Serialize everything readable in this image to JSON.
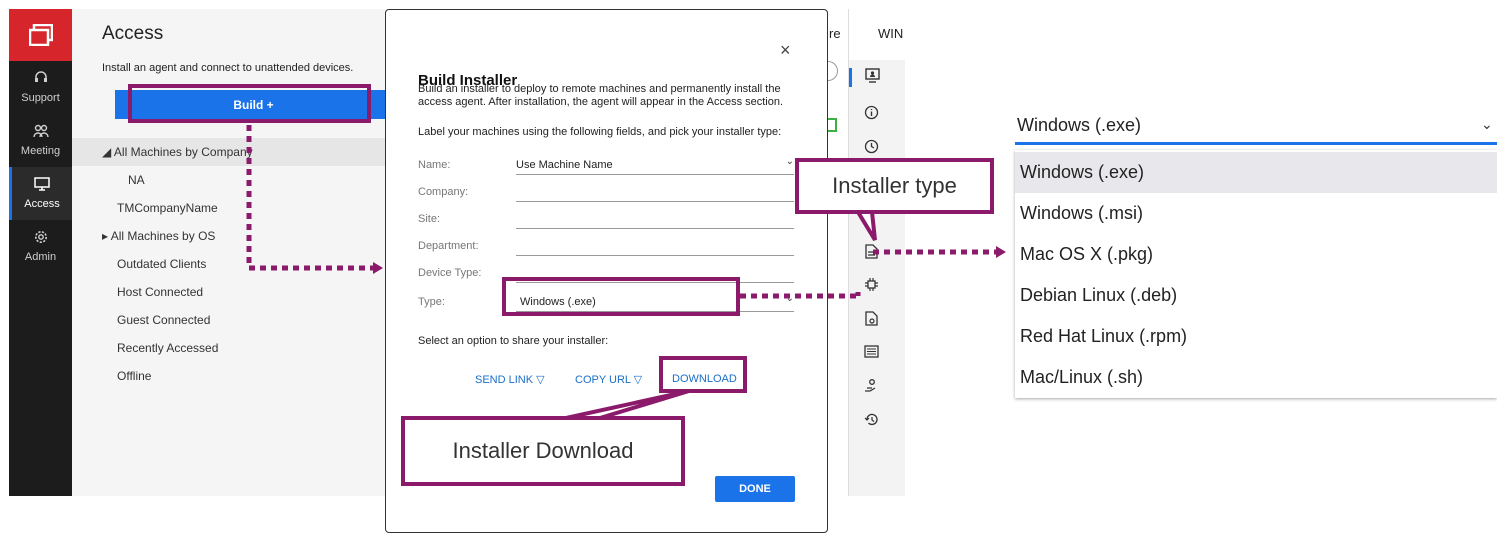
{
  "nav": {
    "items": [
      {
        "label": "Support",
        "icon": "headset-icon"
      },
      {
        "label": "Meeting",
        "icon": "people-icon"
      },
      {
        "label": "Access",
        "icon": "monitor-icon",
        "active": true
      },
      {
        "label": "Admin",
        "icon": "gear-icon"
      }
    ]
  },
  "access": {
    "title": "Access",
    "description": "Install an agent and connect to unattended devices.",
    "build_label": "Build +",
    "tree": [
      {
        "label": "◢ All Machines by Company",
        "indent": 0,
        "selected": true
      },
      {
        "label": "NA",
        "indent": 1
      },
      {
        "label": "TMCompanyName",
        "indent": 1
      },
      {
        "label": "▸ All Machines by OS",
        "indent": 0
      },
      {
        "label": "Outdated Clients",
        "indent": 0
      },
      {
        "label": "Host Connected",
        "indent": 0
      },
      {
        "label": "Guest Connected",
        "indent": 0
      },
      {
        "label": "Recently Accessed",
        "indent": 0
      },
      {
        "label": "Offline",
        "indent": 0
      }
    ]
  },
  "background": {
    "cut_text_1": "re",
    "cut_text_2": "WIN"
  },
  "dialog": {
    "title": "Build Installer",
    "close_glyph": "×",
    "intro": "Build an installer to deploy to remote machines and permanently install the access agent. After installation, the agent will appear in the Access section.",
    "fields_hint": "Label your machines using the following fields, and pick your installer type:",
    "fields": [
      {
        "label": "Name:",
        "value": "Use Machine Name",
        "dropdown": true
      },
      {
        "label": "Company:",
        "value": ""
      },
      {
        "label": "Site:",
        "value": ""
      },
      {
        "label": "Department:",
        "value": ""
      },
      {
        "label": "Device Type:",
        "value": ""
      },
      {
        "label": "Type:",
        "value": "Windows (.exe)",
        "dropdown": true
      }
    ],
    "share_label": "Select an option to share your installer:",
    "send_link": "SEND LINK ▽",
    "copy_url": "COPY URL ▽",
    "download": "DOWNLOAD",
    "done": "DONE"
  },
  "callouts": {
    "installer_type": "Installer type",
    "installer_download": "Installer Download",
    "accent_color": "#8b1a6a"
  },
  "dropdown": {
    "selected": "Windows (.exe)",
    "options": [
      "Windows (.exe)",
      "Windows (.msi)",
      "Mac OS X (.pkg)",
      "Debian Linux (.deb)",
      "Red Hat Linux (.rpm)",
      "Mac/Linux (.sh)"
    ]
  },
  "colors": {
    "brand_red": "#d7262b",
    "primary_blue": "#1a73e8",
    "nav_bg": "#1c1c1c"
  }
}
